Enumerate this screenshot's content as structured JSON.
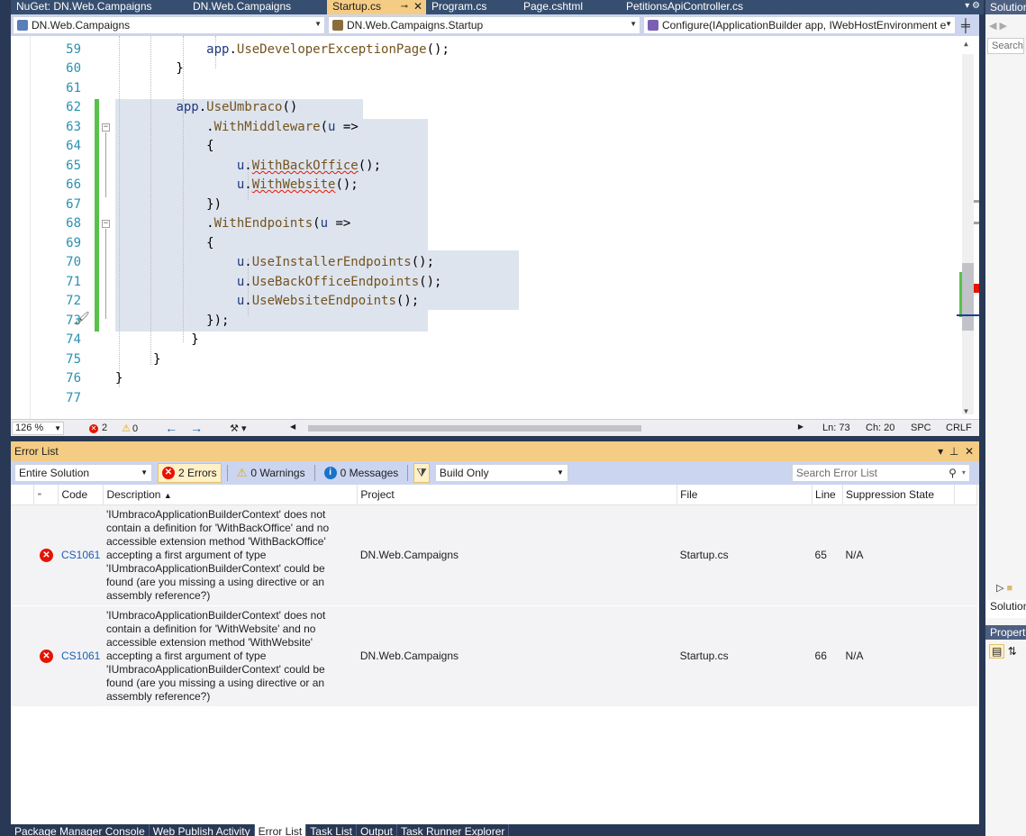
{
  "doc_tabs": [
    {
      "label": "NuGet: DN.Web.Campaigns",
      "active": false
    },
    {
      "label": "DN.Web.Campaigns",
      "active": false
    },
    {
      "label": "Startup.cs",
      "active": true
    },
    {
      "label": "Program.cs",
      "active": false
    },
    {
      "label": "Page.cshtml",
      "active": false
    },
    {
      "label": "PetitionsApiController.cs",
      "active": false
    }
  ],
  "navbar": {
    "project": "DN.Web.Campaigns",
    "type": "DN.Web.Campaigns.Startup",
    "member": "Configure(IApplicationBuilder app, IWebHostEnvironment e"
  },
  "code_lines": [
    {
      "n": "59",
      "text": "            app.UseDeveloperExceptionPage();"
    },
    {
      "n": "60",
      "text": "        }"
    },
    {
      "n": "61",
      "text": ""
    },
    {
      "n": "62",
      "text": "        app.UseUmbraco()"
    },
    {
      "n": "63",
      "text": "            .WithMiddleware(u =>"
    },
    {
      "n": "64",
      "text": "            {"
    },
    {
      "n": "65",
      "text": "                u.WithBackOffice();"
    },
    {
      "n": "66",
      "text": "                u.WithWebsite();"
    },
    {
      "n": "67",
      "text": "            })"
    },
    {
      "n": "68",
      "text": "            .WithEndpoints(u =>"
    },
    {
      "n": "69",
      "text": "            {"
    },
    {
      "n": "70",
      "text": "                u.UseInstallerEndpoints();"
    },
    {
      "n": "71",
      "text": "                u.UseBackOfficeEndpoints();"
    },
    {
      "n": "72",
      "text": "                u.UseWebsiteEndpoints();"
    },
    {
      "n": "73",
      "text": "            });"
    },
    {
      "n": "74",
      "text": "    }"
    },
    {
      "n": "75",
      "text": "}"
    },
    {
      "n": "76",
      "text": "}"
    },
    {
      "n": "77",
      "text": ""
    }
  ],
  "editor_status": {
    "zoom": "126 %",
    "errors": "2",
    "warnings": "0",
    "line": "Ln: 73",
    "col": "Ch: 20",
    "spc": "SPC",
    "eol": "CRLF"
  },
  "error_list": {
    "title": "Error List",
    "scope": "Entire Solution",
    "errors_btn": "2 Errors",
    "warnings_btn": "0 Warnings",
    "messages_btn": "0 Messages",
    "build_filter": "Build Only",
    "search_placeholder": "Search Error List",
    "columns": [
      "Code",
      "Description",
      "Project",
      "File",
      "Line",
      "Suppression State"
    ],
    "rows": [
      {
        "code": "CS1061",
        "description": "'IUmbracoApplicationBuilderContext' does not contain a definition for 'WithBackOffice' and no accessible extension method 'WithBackOffice' accepting a first argument of type 'IUmbracoApplicationBuilderContext' could be found (are you missing a using directive or an assembly reference?)",
        "project": "DN.Web.Campaigns",
        "file": "Startup.cs",
        "line": "65",
        "suppression": "N/A"
      },
      {
        "code": "CS1061",
        "description": "'IUmbracoApplicationBuilderContext' does not contain a definition for 'WithWebsite' and no accessible extension method 'WithWebsite' accepting a first argument of type 'IUmbracoApplicationBuilderContext' could be found (are you missing a using directive or an assembly reference?)",
        "project": "DN.Web.Campaigns",
        "file": "Startup.cs",
        "line": "66",
        "suppression": "N/A"
      }
    ]
  },
  "bottom_tabs": [
    {
      "label": "Package Manager Console",
      "active": false
    },
    {
      "label": "Web Publish Activity",
      "active": false
    },
    {
      "label": "Error List",
      "active": true
    },
    {
      "label": "Task List",
      "active": false
    },
    {
      "label": "Output",
      "active": false
    },
    {
      "label": "Task Runner Explorer",
      "active": false
    }
  ],
  "right_panel": {
    "solution_title": "Solution",
    "search": "Search S",
    "solution_tab": "Solution",
    "properties_title": "Propertie"
  },
  "colors": {
    "active_tab": "#f5cc84",
    "error": "#e51400",
    "change_bar": "#57c14a",
    "line_number": "#2b91af"
  }
}
